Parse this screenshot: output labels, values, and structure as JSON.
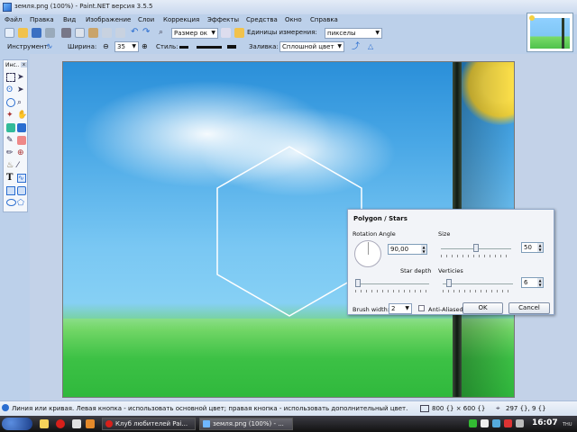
{
  "window": {
    "title": "земля.png (100%) - Paint.NET версия 3.5.5"
  },
  "menu": [
    "Файл",
    "Правка",
    "Вид",
    "Изображение",
    "Слои",
    "Коррекция",
    "Эффекты",
    "Средства",
    "Окно",
    "Справка"
  ],
  "toolbar1": {
    "zoom_value": "Размер ок",
    "units_label": "Единицы измерения:",
    "units_value": "пикселы"
  },
  "toolbar2": {
    "instrument_label": "Инструмент:",
    "width_label": "Ширина:",
    "width_value": "35",
    "style_label": "Стиль:",
    "fill_label": "Заливка:",
    "fill_value": "Сплошной цвет"
  },
  "tools_panel": {
    "title": "Инс..",
    "close": "x"
  },
  "dialog": {
    "title": "Polygon / Stars",
    "rotation_label": "Rotation Angle",
    "rotation_value": "90,00",
    "size_label": "Size",
    "size_value": "50",
    "size_level": 0.5,
    "star_depth_label": "Star depth",
    "star_depth_level": 0.0,
    "verticies_label": "Verticies",
    "verticies_value": "6",
    "verticies_level": 0.05,
    "brush_width_label": "Brush width:",
    "brush_width_value": "2",
    "anti_aliased_label": "Anti-Aliased",
    "ok_label": "OK",
    "cancel_label": "Cancel"
  },
  "statusbar": {
    "hint": "Линия или кривая. Левая кнопка - использовать основной цвет; правая кнопка - использовать дополнительный цвет.",
    "image_size": "800 {} × 600 {}",
    "cursor_pos": "297 {}, 9 {}"
  },
  "taskbar": {
    "items": [
      "Клуб любителей Pai...",
      "земля.png (100%) - ..."
    ],
    "clock": "16:07",
    "day": "THU"
  },
  "colors": {
    "accent": "#2a6dd0",
    "sky": "#4aa8e6",
    "grass": "#3cc145",
    "sun": "#f4d040"
  }
}
